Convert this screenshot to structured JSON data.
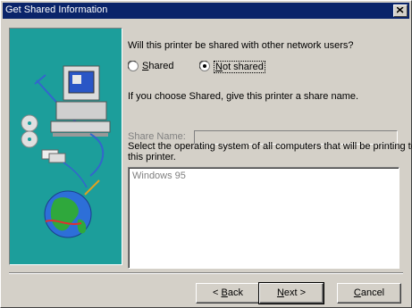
{
  "window": {
    "title": "Get Shared Information"
  },
  "question": "Will this printer be shared with other network users?",
  "options": {
    "shared_prefix": "",
    "shared_accel": "S",
    "shared_rest": "hared",
    "not_shared_prefix": "",
    "not_shared_accel": "N",
    "not_shared_rest": "ot shared",
    "selected": "not_shared"
  },
  "share_hint": "If you choose Shared, give this printer a share name.",
  "share_name": {
    "label": "Share Name:",
    "value": ""
  },
  "os_prompt_line1": "Select the operating system of all computers that will be printing to",
  "os_prompt_line2": "this printer.",
  "os_list": [
    "Windows 95"
  ],
  "buttons": {
    "back_accel": "B",
    "back_rest": "ack",
    "back_prefix": "< ",
    "next_accel": "N",
    "next_rest": "ext >",
    "cancel_accel": "C",
    "cancel_rest": "ancel"
  }
}
